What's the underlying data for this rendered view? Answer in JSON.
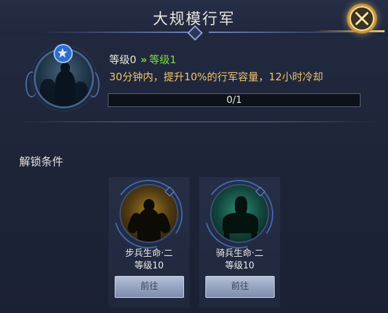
{
  "header": {
    "title": "大规模行军"
  },
  "icons": {
    "close": "close-x-icon",
    "badge": "star-icon",
    "upgrade_arrows": "double-chevron-right-icon"
  },
  "skill": {
    "current_level": "等级0",
    "arrows": "»",
    "next_level": "等级1",
    "description": "30分钟内，提升10%的行军容量，12小时冷却",
    "progress_text": "0/1",
    "progress_value": 0
  },
  "conditions": {
    "title": "解锁条件",
    "items": [
      {
        "name": "步兵生命·二",
        "level": "等级10",
        "button": "前往"
      },
      {
        "name": "骑兵生命·二",
        "level": "等级10",
        "button": "前往"
      }
    ]
  },
  "colors": {
    "accent_gold": "#f1c56a",
    "level_green": "#7ddc44",
    "panel_bg": "#1d2336"
  }
}
